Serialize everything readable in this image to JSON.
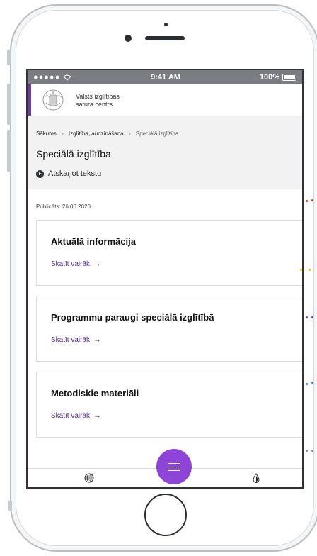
{
  "status_bar": {
    "signal": "●●●●●",
    "time": "9:41 AM",
    "battery": "100%"
  },
  "header": {
    "org_line1": "Valsts izglītības",
    "org_line2": "satura centrs"
  },
  "breadcrumb": {
    "items": [
      "Sākums",
      "Izglītība, audzināšana",
      "Speciālā izglītība"
    ]
  },
  "page": {
    "title": "Speciālā izglītība",
    "tts_label": "Atskaņot tekstu",
    "published": "Publicēts: 26.06.2020."
  },
  "cards": [
    {
      "title": "Aktuālā informācija",
      "link": "Skatīt vairāk"
    },
    {
      "title": "Programmu paraugi speciālā izglītībā",
      "link": "Skatīt vairāk"
    },
    {
      "title": "Metodiskie materiāli",
      "link": "Skatīt vairāk"
    }
  ],
  "link_arrow": "→",
  "colors": {
    "accent": "#6a3d9a",
    "fab": "#8e44d6",
    "link": "#5b2d8e"
  },
  "icons": {
    "globe": "globe-icon",
    "drop": "drop-icon",
    "menu": "menu-icon",
    "play": "play-icon"
  }
}
